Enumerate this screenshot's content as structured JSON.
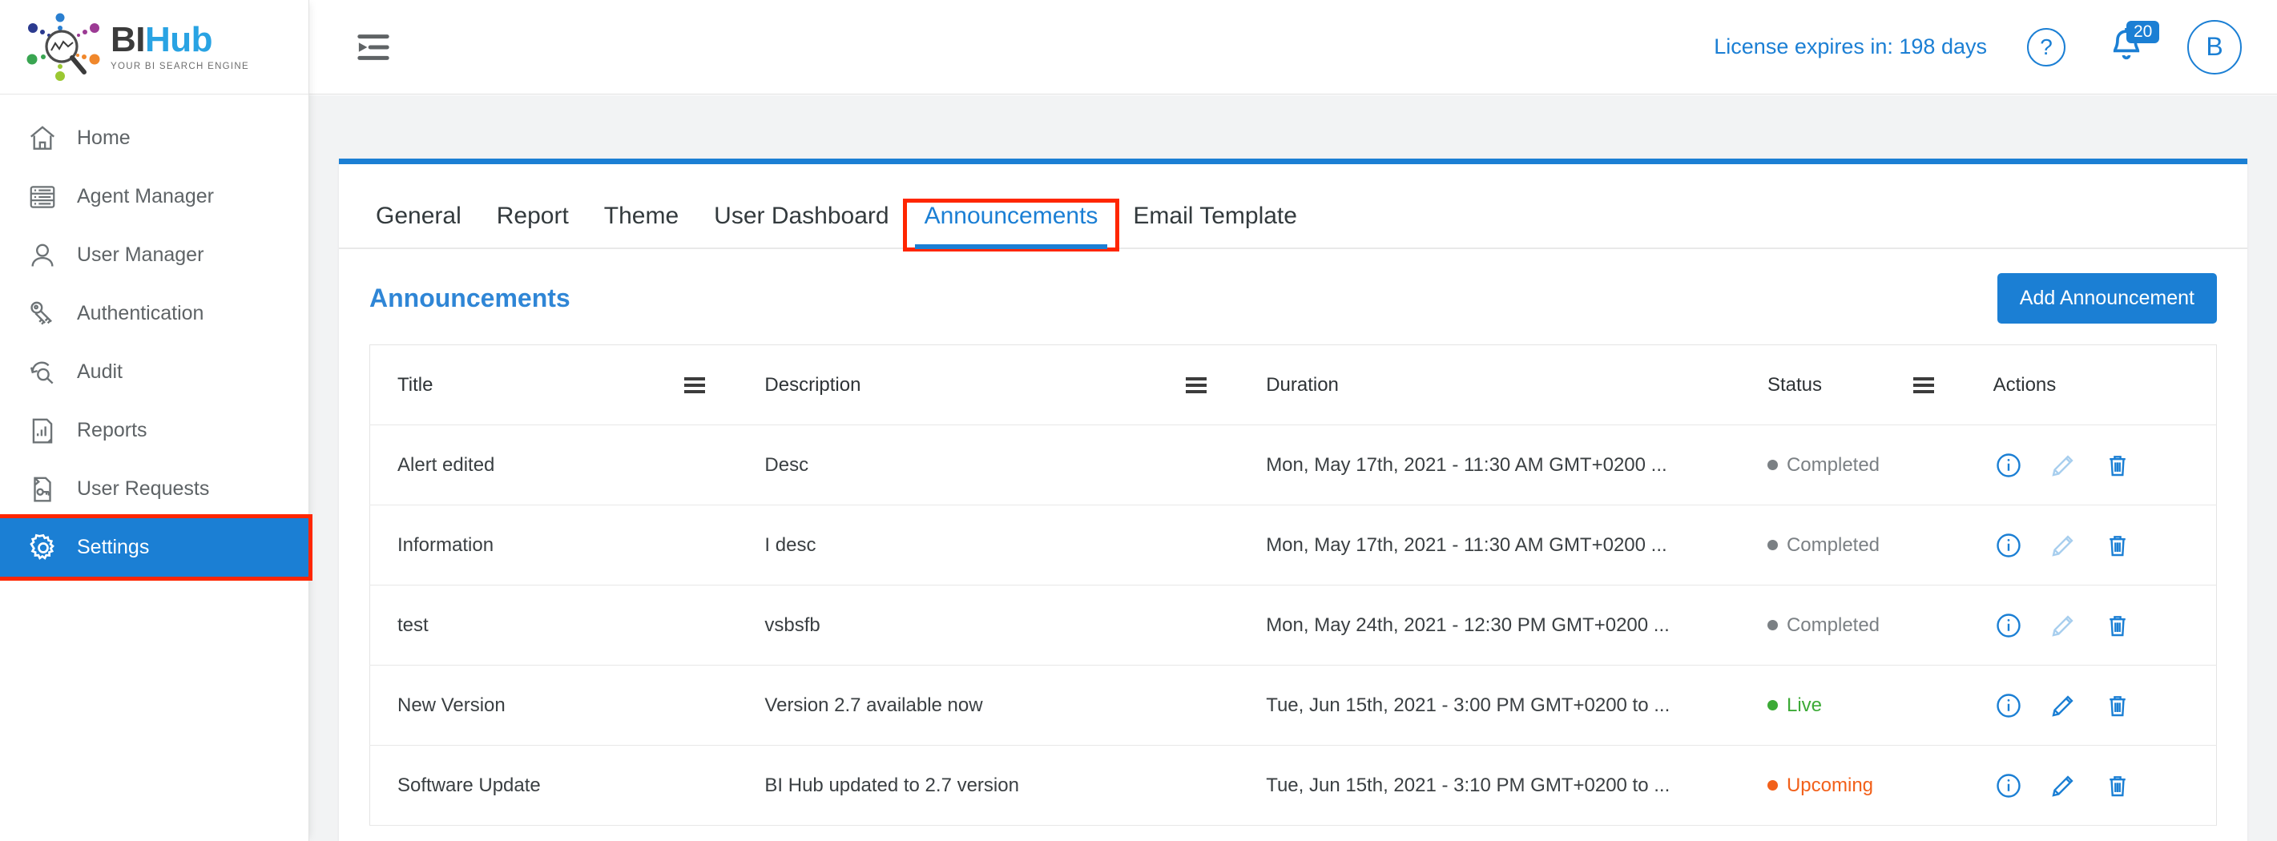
{
  "brand": {
    "title_part1": "BI",
    "title_part2": "Hub",
    "tagline": "YOUR  BI  SEARCH  ENGINE"
  },
  "sidebar": {
    "items": [
      {
        "label": "Home",
        "icon": "home-icon",
        "active": false
      },
      {
        "label": "Agent Manager",
        "icon": "server-list-icon",
        "active": false
      },
      {
        "label": "User Manager",
        "icon": "user-icon",
        "active": false
      },
      {
        "label": "Authentication",
        "icon": "keys-icon",
        "active": false
      },
      {
        "label": "Audit",
        "icon": "audit-search-icon",
        "active": false
      },
      {
        "label": "Reports",
        "icon": "report-chart-icon",
        "active": false
      },
      {
        "label": "User Requests",
        "icon": "request-key-icon",
        "active": false
      },
      {
        "label": "Settings",
        "icon": "gear-icon",
        "active": true
      }
    ]
  },
  "header": {
    "collapse_icon": "collapse-menu-icon",
    "license_text": "License expires in: 198 days",
    "help_icon": "question-mark-icon",
    "bell_icon": "bell-icon",
    "notification_count": "20",
    "avatar_initial": "B"
  },
  "tabs": [
    {
      "label": "General",
      "active": false
    },
    {
      "label": "Report",
      "active": false
    },
    {
      "label": "Theme",
      "active": false
    },
    {
      "label": "User Dashboard",
      "active": false
    },
    {
      "label": "Announcements",
      "active": true
    },
    {
      "label": "Email Template",
      "active": false
    }
  ],
  "panel": {
    "title": "Announcements",
    "add_button": "Add Announcement"
  },
  "table": {
    "columns": [
      {
        "label": "Title",
        "menu": true
      },
      {
        "label": "Description",
        "menu": true
      },
      {
        "label": "Duration",
        "menu": false
      },
      {
        "label": "Status",
        "menu": true
      },
      {
        "label": "Actions",
        "menu": false
      }
    ],
    "rows": [
      {
        "title": "Alert edited",
        "description": "Desc",
        "duration": "Mon, May 17th, 2021 - 11:30 AM GMT+0200 ...",
        "status": "Completed",
        "status_kind": "completed",
        "edit_enabled": false
      },
      {
        "title": "Information",
        "description": "I desc",
        "duration": "Mon, May 17th, 2021 - 11:30 AM GMT+0200 ...",
        "status": "Completed",
        "status_kind": "completed",
        "edit_enabled": false
      },
      {
        "title": "test",
        "description": "vsbsfb",
        "duration": "Mon, May 24th, 2021 - 12:30 PM GMT+0200 ...",
        "status": "Completed",
        "status_kind": "completed",
        "edit_enabled": false
      },
      {
        "title": "New Version",
        "description": "Version 2.7 available now",
        "duration": "Tue, Jun 15th, 2021 - 3:00 PM GMT+0200 to ...",
        "status": "Live",
        "status_kind": "live",
        "edit_enabled": true
      },
      {
        "title": "Software Update",
        "description": "BI Hub updated to 2.7 version",
        "duration": "Tue, Jun 15th, 2021 - 3:10 PM GMT+0200 to ...",
        "status": "Upcoming",
        "status_kind": "upcoming",
        "edit_enabled": true
      }
    ],
    "action_icons": [
      "info-icon",
      "edit-pencil-icon",
      "delete-trash-icon"
    ]
  },
  "colors": {
    "accent_blue": "#1b7fd4",
    "logo_blue": "#29a3e3",
    "highlight_red": "#ff2600",
    "status_live_green": "#3caa36",
    "status_upcoming_orange": "#f2601a",
    "status_completed_gray": "#7b8084"
  }
}
